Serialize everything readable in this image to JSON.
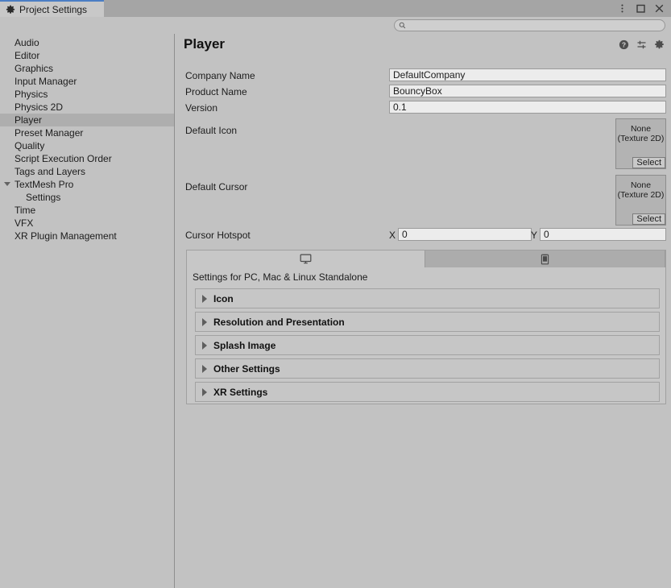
{
  "window": {
    "tab_label": "Project Settings",
    "tab_icon": "gear-icon",
    "controls": [
      {
        "name": "more-options-icon",
        "glyph": "vertical-dots"
      },
      {
        "name": "maximize-icon",
        "glyph": "square"
      },
      {
        "name": "close-icon",
        "glyph": "x"
      }
    ],
    "accent_color": "#4b7ec4"
  },
  "search": {
    "placeholder": "",
    "value": "",
    "icon": "search-icon"
  },
  "sidebar": {
    "items": [
      {
        "label": "Audio",
        "selected": false,
        "child": false,
        "arrow": false
      },
      {
        "label": "Editor",
        "selected": false,
        "child": false,
        "arrow": false
      },
      {
        "label": "Graphics",
        "selected": false,
        "child": false,
        "arrow": false
      },
      {
        "label": "Input Manager",
        "selected": false,
        "child": false,
        "arrow": false
      },
      {
        "label": "Physics",
        "selected": false,
        "child": false,
        "arrow": false
      },
      {
        "label": "Physics 2D",
        "selected": false,
        "child": false,
        "arrow": false
      },
      {
        "label": "Player",
        "selected": true,
        "child": false,
        "arrow": false
      },
      {
        "label": "Preset Manager",
        "selected": false,
        "child": false,
        "arrow": false
      },
      {
        "label": "Quality",
        "selected": false,
        "child": false,
        "arrow": false
      },
      {
        "label": "Script Execution Order",
        "selected": false,
        "child": false,
        "arrow": false
      },
      {
        "label": "Tags and Layers",
        "selected": false,
        "child": false,
        "arrow": false
      },
      {
        "label": "TextMesh Pro",
        "selected": false,
        "child": false,
        "arrow": true
      },
      {
        "label": "Settings",
        "selected": false,
        "child": true,
        "arrow": false
      },
      {
        "label": "Time",
        "selected": false,
        "child": false,
        "arrow": false
      },
      {
        "label": "VFX",
        "selected": false,
        "child": false,
        "arrow": false
      },
      {
        "label": "XR Plugin Management",
        "selected": false,
        "child": false,
        "arrow": false
      }
    ]
  },
  "page": {
    "title": "Player",
    "header_icons": [
      {
        "name": "help-icon",
        "glyph": "?"
      },
      {
        "name": "preset-icon",
        "glyph": "sliders"
      },
      {
        "name": "settings-gear-icon",
        "glyph": "gear"
      }
    ]
  },
  "fields": {
    "company_name": {
      "label": "Company Name",
      "value": "DefaultCompany"
    },
    "product_name": {
      "label": "Product Name",
      "value": "BouncyBox"
    },
    "version": {
      "label": "Version",
      "value": "0.1"
    },
    "default_icon": {
      "label": "Default Icon",
      "object_value": "None",
      "object_type": "(Texture 2D)",
      "select_label": "Select"
    },
    "default_cursor": {
      "label": "Default Cursor",
      "object_value": "None",
      "object_type": "(Texture 2D)",
      "select_label": "Select"
    },
    "cursor_hotspot": {
      "label": "Cursor Hotspot",
      "x_label": "X",
      "x_value": "0",
      "y_label": "Y",
      "y_value": "0"
    }
  },
  "platform": {
    "tabs": [
      {
        "icon": "standalone-monitor-icon",
        "active": true
      },
      {
        "icon": "android-device-icon",
        "active": false
      }
    ],
    "caption": "Settings for PC, Mac & Linux Standalone",
    "sections": [
      {
        "label": "Icon",
        "expanded": false
      },
      {
        "label": "Resolution and Presentation",
        "expanded": false
      },
      {
        "label": "Splash Image",
        "expanded": false
      },
      {
        "label": "Other Settings",
        "expanded": false
      },
      {
        "label": "XR Settings",
        "expanded": false
      }
    ]
  }
}
